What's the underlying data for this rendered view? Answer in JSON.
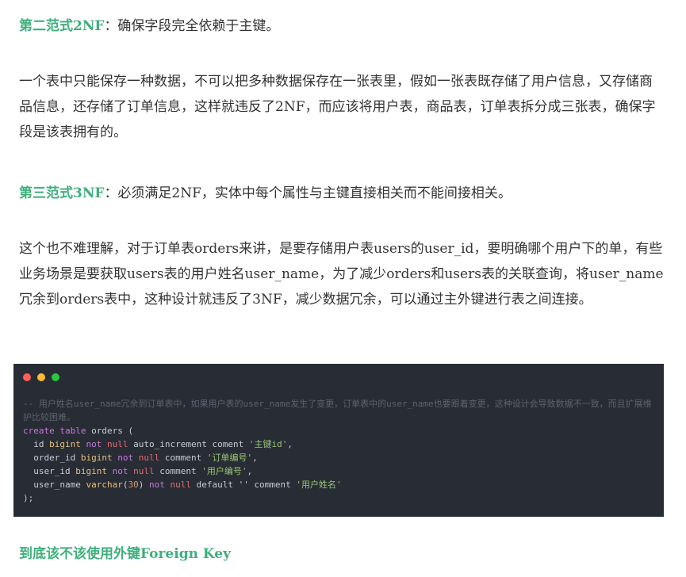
{
  "p1": {
    "label": "第二范式2NF",
    "text": "：确保字段完全依赖于主键。"
  },
  "p2": "一个表中只能保存一种数据，不可以把多种数据保存在一张表里，假如一张表既存储了用户信息，又存储商品信息，还存储了订单信息，这样就违反了2NF，而应该将用户表，商品表，订单表拆分成三张表，确保字段是该表拥有的。",
  "p3": {
    "label": "第三范式3NF",
    "text": "：必须满足2NF，实体中每个属性与主键直接相关而不能间接相关。"
  },
  "p4": "这个也不难理解，对于订单表orders来讲，是要存储用户表users的user_id，要明确哪个用户下的单，有些业务场景是要获取users表的用户姓名user_name，为了减少orders和users表的关联查询，将user_name冗余到orders表中，这种设计就违反了3NF，减少数据冗余，可以通过主外键进行表之间连接。",
  "code": {
    "comment": "-- 用户姓名user_name冗余到订单表中，如果用户表的user_name发生了变更，订单表中的user_name也要跟着变更，这种设计会导致数据不一致，而且扩展维护比较困难。",
    "l1": {
      "a": "create",
      "b": "table",
      "c": " orders ("
    },
    "l2": {
      "name": "  id ",
      "type": "bigint",
      "not": "not",
      "null": "null",
      "rest": " auto_increment coment ",
      "str": "'主键id'",
      "end": ","
    },
    "l3": {
      "name": "  order_id ",
      "type": "bigint",
      "not": "not",
      "null": "null",
      "rest": " comment ",
      "str": "'订单编号'",
      "end": ","
    },
    "l4": {
      "name": "  user_id ",
      "type": "bigint",
      "not": "not",
      "null": "null",
      "rest": " comment ",
      "str": "'用户编号'",
      "end": ","
    },
    "l5": {
      "name": "  user_name ",
      "type": "varchar",
      "p1": "(",
      "num": "30",
      "p2": ")",
      "not": "not",
      "null": "null",
      "rest": " default '' comment ",
      "str": "'用户姓名'"
    },
    "l6": ");"
  },
  "heading": "到底该不该使用外键Foreign Key",
  "colors": {
    "accent": "#3eaf7c",
    "code_bg": "#282c34",
    "dot_red": "#ff5f56",
    "dot_yellow": "#ffbd2e",
    "dot_green": "#27c93f"
  }
}
